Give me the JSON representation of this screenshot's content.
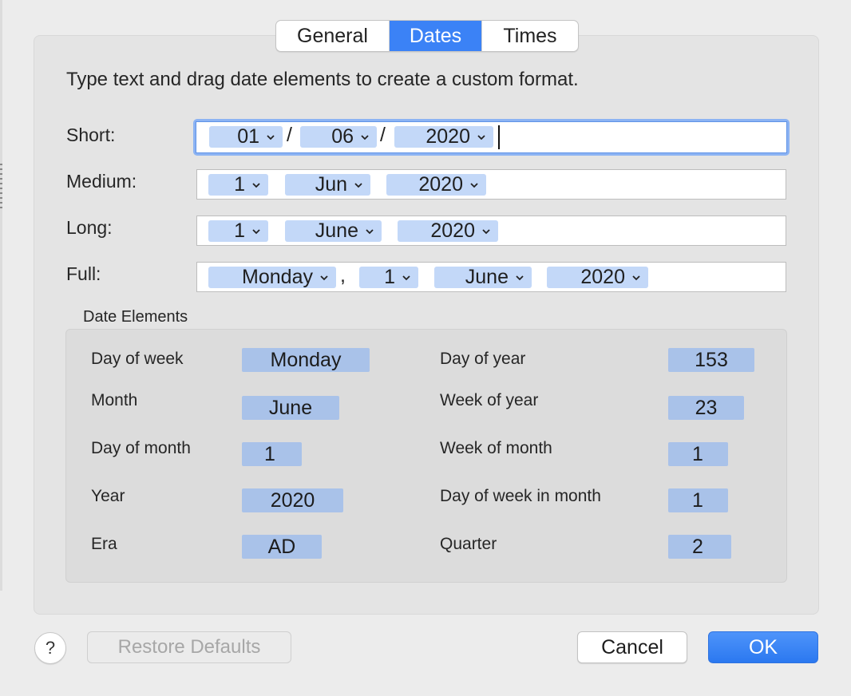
{
  "tabs": [
    {
      "label": "General",
      "selected": false
    },
    {
      "label": "Dates",
      "selected": true
    },
    {
      "label": "Times",
      "selected": false
    }
  ],
  "instruction": "Type text and drag date elements to create a custom format.",
  "formats": {
    "short": {
      "label": "Short:",
      "tokens": [
        "01",
        "06",
        "2020"
      ],
      "separators": [
        "/",
        "/"
      ]
    },
    "medium": {
      "label": "Medium:",
      "tokens": [
        "1",
        "Jun",
        "2020"
      ]
    },
    "long": {
      "label": "Long:",
      "tokens": [
        "1",
        "June",
        "2020"
      ]
    },
    "full": {
      "label": "Full:",
      "tokens": [
        "Monday",
        "1",
        "June",
        "2020"
      ],
      "separators": [
        ","
      ]
    }
  },
  "date_elements": {
    "title": "Date Elements",
    "left": [
      {
        "label": "Day of week",
        "value": "Monday"
      },
      {
        "label": "Month",
        "value": "June"
      },
      {
        "label": "Day of month",
        "value": "1"
      },
      {
        "label": "Year",
        "value": "2020"
      },
      {
        "label": "Era",
        "value": "AD"
      }
    ],
    "right": [
      {
        "label": "Day of year",
        "value": "153"
      },
      {
        "label": "Week of year",
        "value": "23"
      },
      {
        "label": "Week of month",
        "value": "1"
      },
      {
        "label": "Day of week in month",
        "value": "1"
      },
      {
        "label": "Quarter",
        "value": "2"
      }
    ]
  },
  "buttons": {
    "help": "?",
    "restore": "Restore Defaults",
    "cancel": "Cancel",
    "ok": "OK"
  },
  "colors": {
    "accent": "#3b82f6",
    "token_bg": "#c3d8f8",
    "element_chip_bg": "#a9c2e9"
  },
  "icons": {
    "token_dropdown": "chevron-down-icon",
    "help": "question-mark-icon"
  }
}
